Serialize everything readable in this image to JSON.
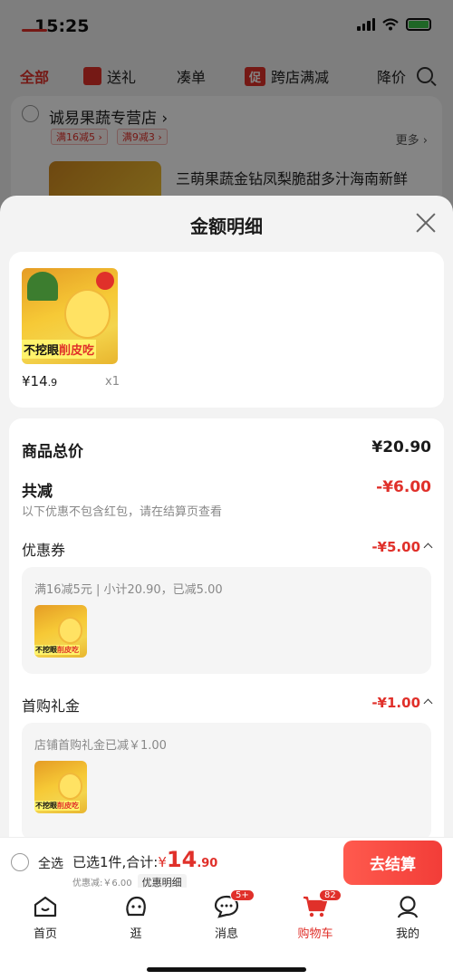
{
  "status": {
    "time": "15:25"
  },
  "categories": [
    {
      "label": "全部",
      "active": true
    },
    {
      "label": "送礼"
    },
    {
      "label": "凑单"
    },
    {
      "badge": "促",
      "label": "跨店满减"
    },
    {
      "label": "降价"
    }
  ],
  "store": {
    "name": "诚易果蔬专营店",
    "tags": [
      "满16减5",
      "满9减3"
    ],
    "more": "更多",
    "product_title": "三萌果蔬金钻凤梨脆甜多汁海南新鲜"
  },
  "sheet": {
    "title": "金额明细",
    "product": {
      "caption_black": "不挖眼",
      "caption_red": "削皮吃",
      "price_main": "¥14",
      "price_cents": ".9",
      "qty": "x1"
    },
    "rows": {
      "total_label": "商品总价",
      "total_value": "¥20.90",
      "reduce_label": "共减",
      "reduce_value": "-¥6.00",
      "note": "以下优惠不包含红包，请在结算页查看"
    },
    "coupon": {
      "label": "优惠券",
      "value": "-¥5.00",
      "detail": "满16减5元 | 小计20.90，已减5.00"
    },
    "first_gift": {
      "label": "首购礼金",
      "value": "-¥1.00",
      "detail": "店铺首购礼金已减￥1.00"
    }
  },
  "checkout": {
    "select_all": "全选",
    "summary_prefix": "已选1件,合计:",
    "currency": "¥",
    "total_big": "14",
    "total_cents": ".90",
    "discount": "优惠减:￥6.00",
    "detail_link": "优惠明细",
    "button": "去结算"
  },
  "tabbar": [
    {
      "label": "首页",
      "icon": "home-icon"
    },
    {
      "label": "逛",
      "icon": "stroll-icon"
    },
    {
      "label": "消息",
      "icon": "message-icon",
      "badge": "5+"
    },
    {
      "label": "购物车",
      "icon": "cart-icon",
      "badge": "82",
      "active": true
    },
    {
      "label": "我的",
      "icon": "profile-icon"
    }
  ],
  "colors": {
    "accent": "#e0302a",
    "button_start": "#ff5a4e",
    "button_end": "#f23d38"
  }
}
